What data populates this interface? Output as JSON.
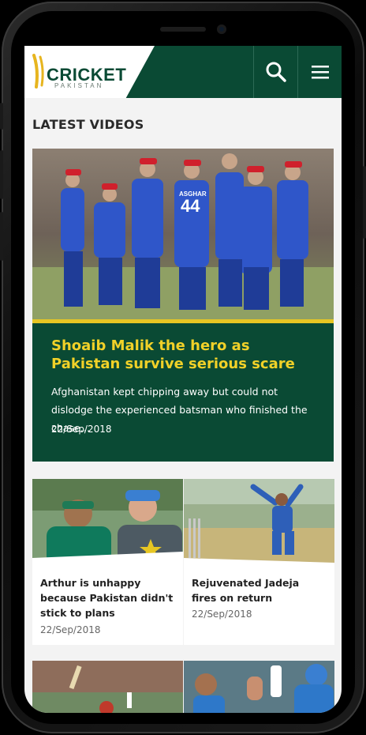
{
  "brand": {
    "logo_text": "CRICKET",
    "logo_sub": "PAKISTAN",
    "colors": {
      "green": "#0a4a34",
      "gold": "#e7c623",
      "title_yellow": "#f1d128"
    }
  },
  "header": {
    "search_icon": "search-icon",
    "menu_icon": "hamburger-menu-icon"
  },
  "section": {
    "title": "LATEST VIDEOS"
  },
  "featured": {
    "title": "Shoaib Malik the hero as Pakistan survive serious scare",
    "description": "Afghanistan kept chipping away but could not dislodge the experienced batsman who finished the chase…",
    "date": "22/Sep/2018"
  },
  "cards": [
    {
      "title": "Arthur is unhappy because Pakistan didn't stick to plans",
      "date": "22/Sep/2018"
    },
    {
      "title": "Rejuvenated Jadeja fires on return",
      "date": "22/Sep/2018"
    }
  ]
}
